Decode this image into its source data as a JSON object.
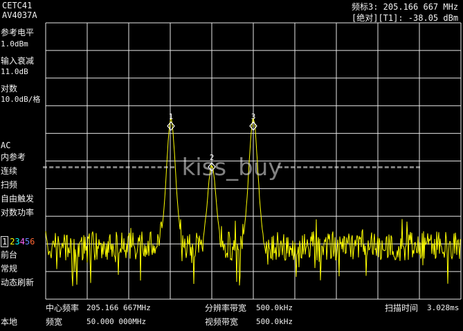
{
  "instrument": {
    "brand": "CETC41",
    "model": "AV4037A"
  },
  "marker": {
    "line1": "频标3: 205.166 667 MHz",
    "line2": "[绝对][T1]: -38.05 dBm"
  },
  "left_panel": {
    "ref_level_label": "参考电平",
    "ref_level_value": "1.0dBm",
    "atten_label": "输入衰减",
    "atten_value": "11.0dB",
    "scale_label": "对数",
    "scale_value": "10.0dB/格",
    "coupling": "AC",
    "ref_source": "内参考",
    "sweep_mode": "连续",
    "sweep_type": "扫频",
    "trigger": "自由触发",
    "detector": "对数功率",
    "traces": [
      "1",
      "2",
      "3",
      "4",
      "5",
      "6"
    ],
    "display": "前台",
    "mode": "常规",
    "refresh": "动态刷新"
  },
  "bottom": {
    "center_label": "中心频率",
    "center_value": "205.166 667MHz",
    "rbw_label": "分辨率带宽",
    "rbw_value": "500.0kHz",
    "sweep_label": "扫描时间",
    "sweep_value": "3.028ms",
    "local": "本地",
    "span_label": "频宽",
    "span_value": "50.000 000MHz",
    "vbw_label": "视频带宽",
    "vbw_value": "500.0kHz"
  },
  "markers": [
    {
      "label": "1"
    },
    {
      "label": "2"
    },
    {
      "label": "3"
    }
  ],
  "watermark": "kiss_buy",
  "colors": {
    "trace": "#ffff00",
    "grid": "#e8e8e8",
    "background": "#000000",
    "trace_colors": [
      "#ffffff",
      "#ffff00",
      "#00ffff",
      "#ff66ff",
      "#6688ff",
      "#ff6633"
    ]
  }
}
